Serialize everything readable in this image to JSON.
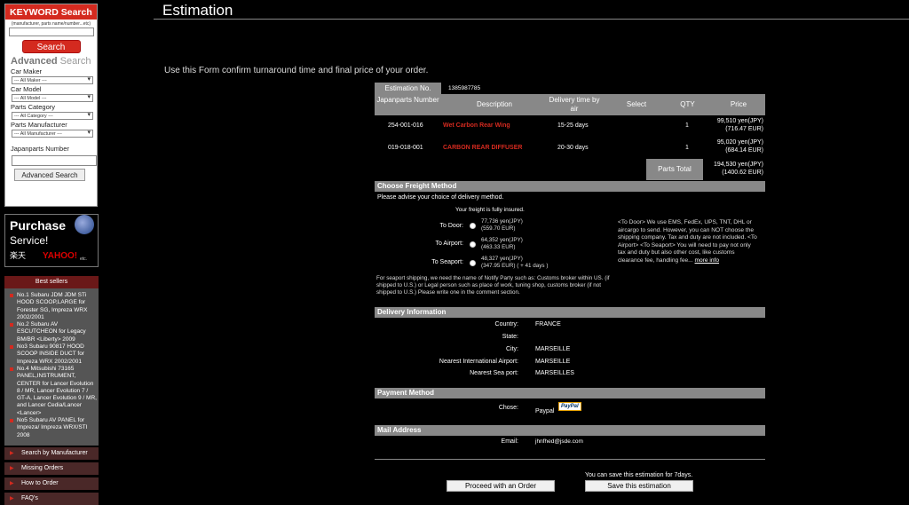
{
  "sidebar": {
    "keyword_title": "KEYWORD Search",
    "keyword_hint": "(manufacturer, parts name/number...etc)",
    "search_label": "Search",
    "advanced_title": "Advanced",
    "advanced_title_suffix": "Search",
    "car_maker_label": "Car Maker",
    "car_maker_value": "--- All Maker ---",
    "car_model_label": "Car Model",
    "car_model_value": "--- All Model ---",
    "parts_category_label": "Parts Category",
    "parts_category_value": "--- All Category ---",
    "parts_manufacturer_label": "Parts Manufacturer",
    "parts_manufacturer_value": "--- All Manufacturer ---",
    "japanparts_number_label": "Japanparts Number",
    "advanced_search_label": "Advanced Search",
    "promo": {
      "line1": "Purchase",
      "line2": "Service!",
      "rakuten": "楽天",
      "yahoo": "YAHOO!",
      "etc": "etc."
    },
    "best_sellers_title": "Best sellers",
    "best_sellers": [
      "No.1 Subaru JDM JDM STi HOOD SCOOP,LARGE for Forester SG, Impreza WRX 2002/2001",
      "No.2 Subaru AV ESCUTCHEON for Legacy BM/BR <Liberty> 2009",
      "No3 Subaru 90817 HOOD SCOOP INSIDE DUCT for Impreza WRX 2002/2001",
      "No.4 Mitsubishi 73165 PANEL,INSTRUMENT, CENTER for Lancer Evolution 8 / MR, Lancer Evolution 7 / GT-A, Lancer Evolution 9 / MR, and Lancer Cedia/Lancer <Lancer>",
      "No5 Subaru AV PANEL for Impreza/ Impreza WRX/STI 2008"
    ],
    "menu": [
      "Search by Manufacturer",
      "Missing Orders",
      "How to Order",
      "FAQ's"
    ]
  },
  "page": {
    "title": "Estimation",
    "intro": "Use this Form confirm turnaround time and final price of your order."
  },
  "estimation": {
    "number_label": "Estimation No.",
    "number_value": "1385987785",
    "columns": [
      "Japanparts Number",
      "Description",
      "Delivery time by air",
      "Select",
      "QTY",
      "Price"
    ],
    "rows": [
      {
        "number": "254-001-016",
        "description": "Wet Carbon Rear Wing",
        "delivery": "15-25 days",
        "qty": "1",
        "price_jpy": "99,510 yen(JPY)",
        "price_eur": "(716.47 EUR)"
      },
      {
        "number": "019-018-001",
        "description": "CARBON REAR DIFFUSER",
        "delivery": "20-30 days",
        "qty": "1",
        "price_jpy": "95,020 yen(JPY)",
        "price_eur": "(684.14 EUR)"
      }
    ],
    "parts_total_label": "Parts Total",
    "parts_total_jpy": "194,530 yen(JPY)",
    "parts_total_eur": "(1400.62 EUR)"
  },
  "freight": {
    "title": "Choose Freight Method",
    "advice": "Please advise your choice of delivery method.",
    "insured": "Your freight is fully insured.",
    "options": [
      {
        "label": "To Door:",
        "jpy": "77,736 yen(JPY)",
        "eur": "(559.70 EUR)"
      },
      {
        "label": "To Airport:",
        "jpy": "64,352 yen(JPY)",
        "eur": "(463.33 EUR)"
      },
      {
        "label": "To Seaport:",
        "jpy": "48,327 yen(JPY)",
        "eur": "(347.95 EUR) ( + 41 days )"
      }
    ],
    "seaport_note": "For seaport shipping, we need the name of Notify Party such as: Customs broker within US. (if shipped to U.S.) or Legal person such as place of work, tuning shop, customs broker (if not shipped to U.S.)  Please write one in the comment section.",
    "side_note": "<To Door> We use EMS, FedEx, UPS, TNT, DHL or aircargo to send. However, you can NOT choose the shipping company. Tax and duty are not included. <To Airport> <To Seaport> You will need to pay not only tax and duty but also other cost, like customs clearance fee, handling fee...",
    "more_info": "more info"
  },
  "delivery": {
    "title": "Delivery Information",
    "fields": [
      {
        "label": "Country:",
        "value": "FRANCE"
      },
      {
        "label": "State:",
        "value": ""
      },
      {
        "label": "City:",
        "value": "MARSEILLE"
      },
      {
        "label": "Nearest International Airport:",
        "value": "MARSEILLE"
      },
      {
        "label": "Nearest Sea port:",
        "value": "MARSEILLES"
      }
    ]
  },
  "payment": {
    "title": "Payment Method",
    "chose_label": "Chose:",
    "chose_value": "Paypal",
    "paypal_logo": "PayPal"
  },
  "mail": {
    "title": "Mail Address",
    "email_label": "Email:",
    "email_value": "jhnfhed@jsde.com"
  },
  "actions": {
    "proceed_label": "Proceed with an Order",
    "save_note": "You can save this estimation for 7days.",
    "save_label": "Save this estimation"
  },
  "colors": {
    "accent_red": "#d42a1f",
    "header_gray": "#888888",
    "background": "#000000"
  }
}
